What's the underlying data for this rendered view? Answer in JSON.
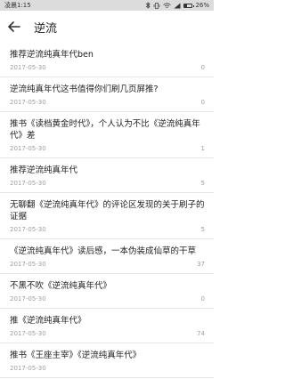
{
  "status_bar": {
    "time": "凌晨1:15",
    "battery_text": "26%",
    "battery_level": 0.26
  },
  "toolbar": {
    "title": "逆流"
  },
  "posts": [
    {
      "title": "推荐逆流纯真年代ben",
      "date": "2017-05-30",
      "count": "0"
    },
    {
      "title": "逆流纯真年代这书值得你们刷几页屏推?",
      "date": "2017-05-30",
      "count": "0"
    },
    {
      "title": "推书《读档黄金时代》，个人认为不比《逆流纯真年代》差",
      "date": "2017-05-30",
      "count": "1"
    },
    {
      "title": "推荐逆流纯真年代",
      "date": "2017-05-30",
      "count": "5"
    },
    {
      "title": "无聊翻《逆流纯真年代》的评论区发现的关于刷子的证据",
      "date": "2017-05-30",
      "count": "5"
    },
    {
      "title": "《逆流纯真年代》读后感，一本伪装成仙草的干草",
      "date": "2017-05-30",
      "count": "37"
    },
    {
      "title": "不黑不吹《逆流纯真年代》",
      "date": "2017-05-30",
      "count": "0"
    },
    {
      "title": "推《逆流纯真年代》",
      "date": "2017-05-30",
      "count": "74"
    },
    {
      "title": "推书《王座主宰》《逆流纯真年代》",
      "date": "2017-05-30",
      "count": ""
    }
  ]
}
